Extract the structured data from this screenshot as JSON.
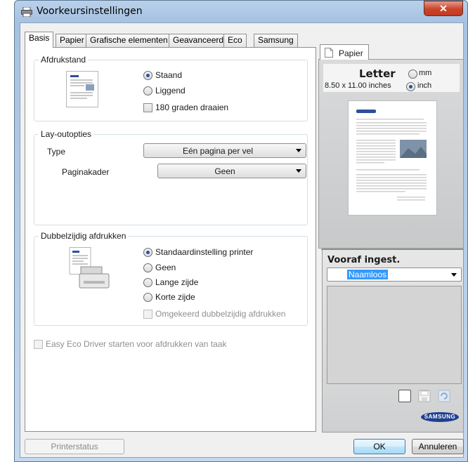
{
  "window": {
    "title": "Voorkeursinstellingen",
    "close_glyph": "✕"
  },
  "tabs": [
    {
      "label": "Basis"
    },
    {
      "label": "Papier"
    },
    {
      "label": "Grafische elementen"
    },
    {
      "label": "Geavanceerd"
    },
    {
      "label": "Eco"
    },
    {
      "label": "Samsung"
    }
  ],
  "orientation": {
    "legend": "Afdrukstand",
    "options": [
      {
        "label": "Staand",
        "selected": true
      },
      {
        "label": "Liggend",
        "selected": false
      }
    ],
    "rotate_label": "180 graden draaien",
    "rotate_checked": false
  },
  "layout": {
    "legend": "Lay-outopties",
    "type_label": "Type",
    "type_value": "Eén pagina per vel",
    "border_label": "Paginakader",
    "border_value": "Geen"
  },
  "duplex": {
    "legend": "Dubbelzijdig afdrukken",
    "options": [
      {
        "label": "Standaardinstelling printer",
        "selected": true
      },
      {
        "label": "Geen",
        "selected": false
      },
      {
        "label": "Lange zijde",
        "selected": false
      },
      {
        "label": "Korte zijde",
        "selected": false
      }
    ],
    "reverse_label": "Omgekeerd dubbelzijdig afdrukken",
    "reverse_checked": false
  },
  "eco_driver": {
    "label": "Easy Eco Driver starten voor afdrukken van taak",
    "checked": false
  },
  "preview": {
    "tab_label": "Papier",
    "paper_name": "Letter",
    "paper_size": "8.50 x 11.00 inches",
    "units": [
      {
        "label": "mm",
        "selected": false
      },
      {
        "label": "inch",
        "selected": true
      }
    ]
  },
  "presets": {
    "label": "Vooraf ingest.",
    "value": "Naamloos"
  },
  "brand": {
    "logo_text": "SAMSUNG",
    "color": "#1f3f8f"
  },
  "buttons": {
    "status": "Printerstatus",
    "ok": "OK",
    "cancel": "Annuleren"
  },
  "colors": {
    "selection": "#3399ff",
    "radio_dot": "#1d55a8"
  }
}
